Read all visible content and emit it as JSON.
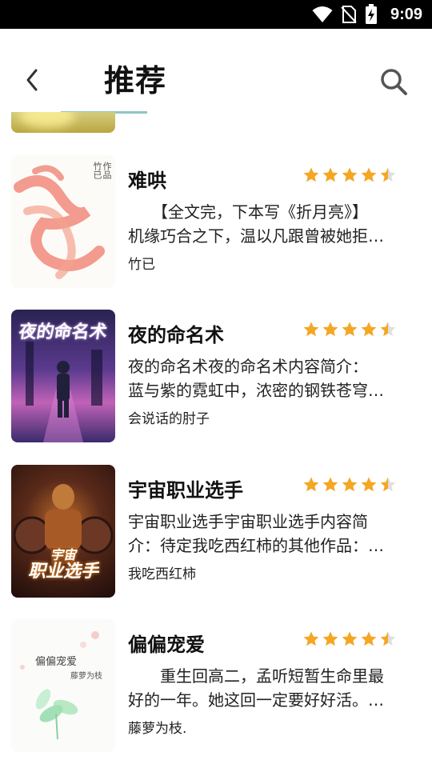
{
  "status_bar": {
    "time": "9:09"
  },
  "header": {
    "title": "推荐"
  },
  "books": [
    {
      "title": "难哄",
      "rating": 4.5,
      "desc_lines": [
        "　　【全文完，下本写《折月亮》】",
        "机缘巧合之下，温以凡跟曾被她拒…"
      ],
      "author": "竹已",
      "cover_text": {
        "author": "竹已",
        "suffix": "作品"
      }
    },
    {
      "title": "夜的命名术",
      "rating": 4.5,
      "desc_lines": [
        "夜的命名术夜的命名术内容简介：",
        "蓝与紫的霓虹中，浓密的钢铁苍穹…"
      ],
      "author": "会说话的肘子",
      "cover_text": {
        "title": "夜的命名术"
      }
    },
    {
      "title": "宇宙职业选手",
      "rating": 4.5,
      "desc_lines": [
        "宇宙职业选手宇宙职业选手内容简",
        "介：待定我吃西红柿的其他作品：…"
      ],
      "author": "我吃西红柿",
      "cover_text": {
        "title_top": "宇宙",
        "title_bottom": "职业选手"
      }
    },
    {
      "title": "偏偏宠爱",
      "rating": 4.5,
      "desc_lines": [
        "　　重生回高二，孟听短暂生命里最",
        "好的一年。她这回一定要好好活。…"
      ],
      "author": "藤萝为枝.",
      "cover_text": {
        "title": "偏偏宠爱",
        "author": "藤萝为枝"
      }
    }
  ],
  "colors": {
    "star": "#f5a623",
    "star_empty": "#e0e0e0",
    "tab_indicator": "#8fc6c4"
  }
}
